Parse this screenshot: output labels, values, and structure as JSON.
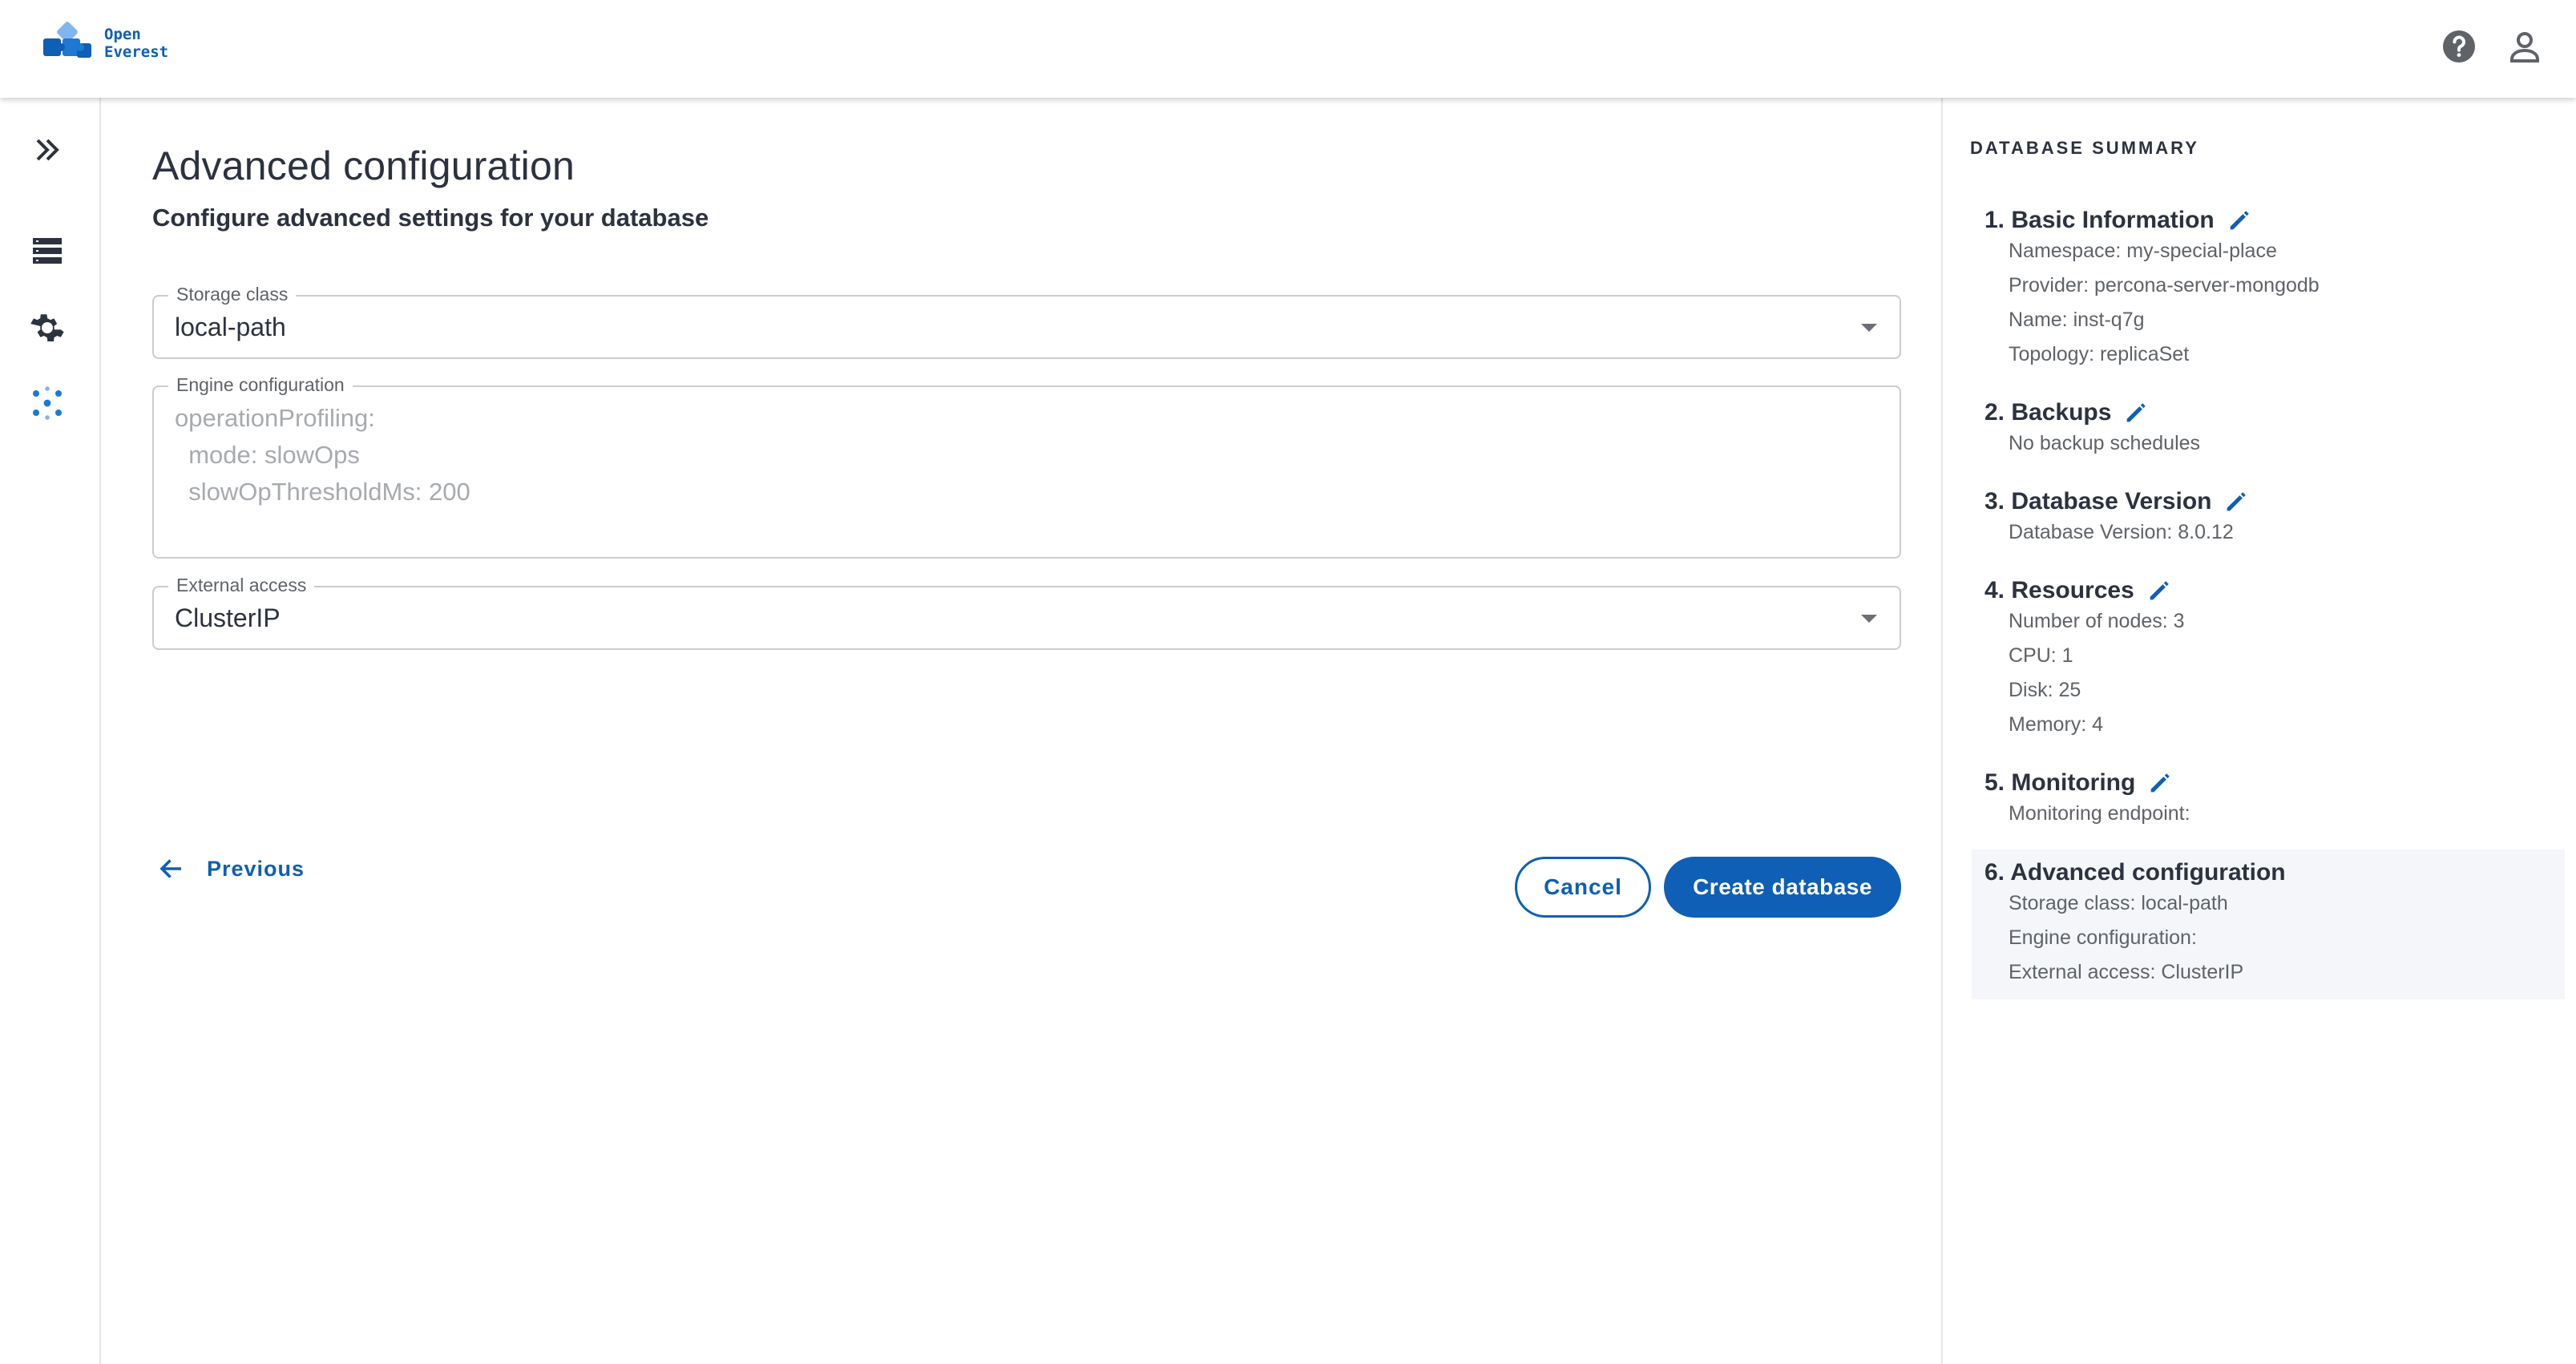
{
  "header": {
    "logo_line1": "Open",
    "logo_line2": "Everest",
    "icons": [
      "help-icon",
      "account-icon"
    ]
  },
  "leftnav": {
    "items": [
      "expand-icon",
      "databases-icon",
      "settings-icon",
      "namespaces-icon"
    ]
  },
  "main": {
    "title": "Advanced configuration",
    "subtitle": "Configure advanced settings for your database",
    "storage_class": {
      "label": "Storage class",
      "value": "local-path"
    },
    "engine_configuration": {
      "label": "Engine configuration",
      "placeholder_lines": [
        "operationProfiling:",
        "  mode: slowOps",
        "  slowOpThresholdMs: 200"
      ]
    },
    "external_access": {
      "label": "External access",
      "value": "ClusterIP"
    },
    "previous_label": "Previous",
    "cancel_label": "Cancel",
    "create_label": "Create database"
  },
  "summary": {
    "title": "DATABASE SUMMARY",
    "sections": [
      {
        "title": "1. Basic Information",
        "items": [
          "Namespace: my-special-place",
          "Provider: percona-server-mongodb",
          "Name: inst-q7g",
          "Topology: replicaSet"
        ]
      },
      {
        "title": "2. Backups",
        "items": [
          "No backup schedules"
        ]
      },
      {
        "title": "3. Database Version",
        "items": [
          "Database Version: 8.0.12"
        ]
      },
      {
        "title": "4. Resources",
        "items": [
          "Number of nodes: 3",
          "CPU: 1",
          "Disk: 25",
          "Memory: 4"
        ]
      },
      {
        "title": "5. Monitoring",
        "items": [
          "Monitoring endpoint:"
        ]
      },
      {
        "title": "6. Advanced configuration",
        "items": [
          "Storage class: local-path",
          "Engine configuration:",
          "External access: ClusterIP"
        ]
      }
    ]
  },
  "colors": {
    "accent": "#0e5fb5",
    "text": "#2c323e",
    "muted": "#5f6368"
  }
}
